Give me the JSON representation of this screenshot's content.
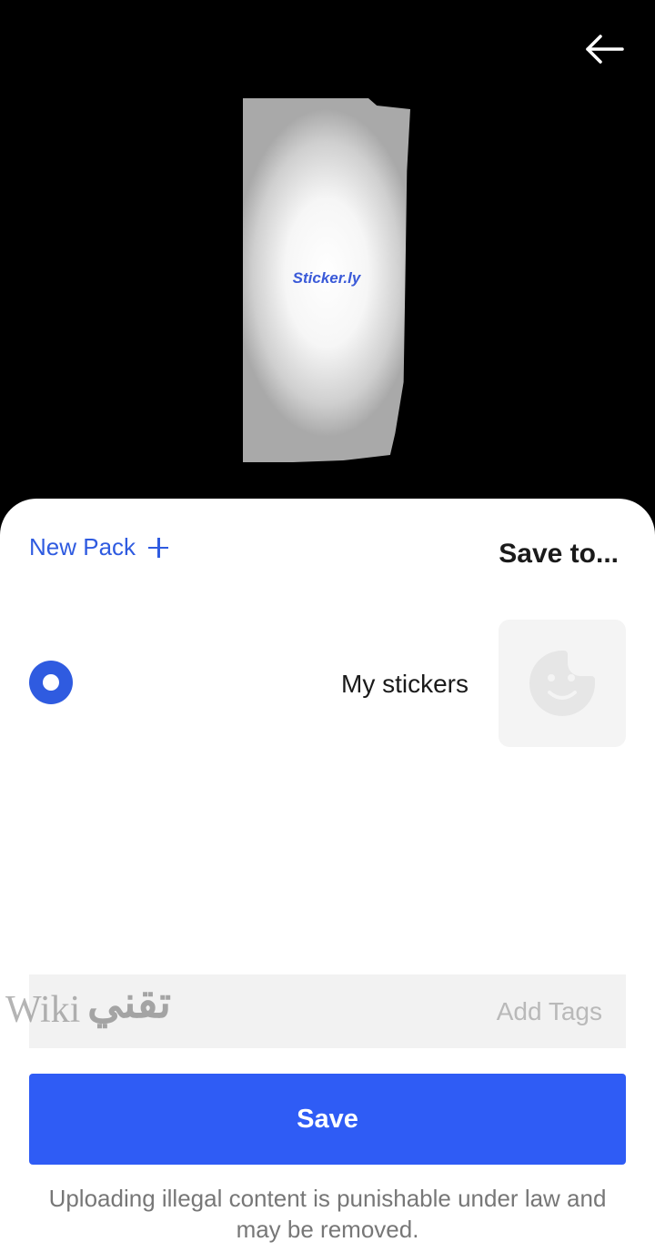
{
  "header": {
    "back_icon": "arrow-left-icon"
  },
  "preview": {
    "brand_text": "Sticker.ly"
  },
  "sheet": {
    "new_pack_label": "New Pack",
    "new_pack_icon": "plus-icon",
    "title": "Save to..."
  },
  "packs": [
    {
      "name": "My stickers",
      "selected": true,
      "thumbnail_icon": "smiley-sticker-icon"
    }
  ],
  "tags": {
    "placeholder": "Add Tags",
    "value": ""
  },
  "actions": {
    "save_label": "Save"
  },
  "footer": {
    "notice": "Uploading illegal content is punishable under law and may be removed."
  },
  "watermark": {
    "latin": "Wiki",
    "arabic": "تقني"
  },
  "colors": {
    "accent": "#2F5CF5",
    "link": "#2F5BE0",
    "background_top": "#000000",
    "sheet": "#FFFFFF"
  }
}
